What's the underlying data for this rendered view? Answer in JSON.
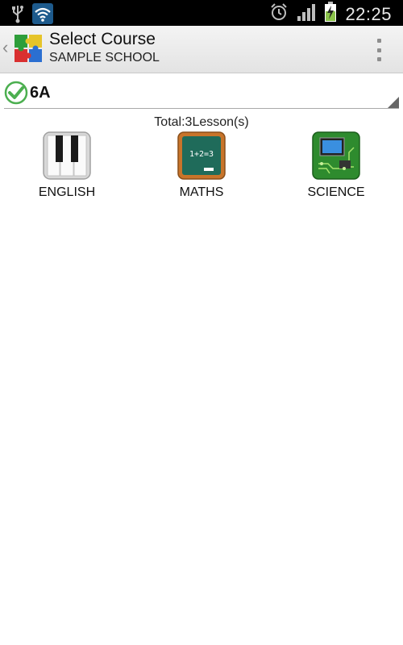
{
  "status_bar": {
    "time": "22:25",
    "icons": [
      "usb-icon",
      "wifi-icon",
      "alarm-icon",
      "signal-icon",
      "battery-charging-icon"
    ]
  },
  "action_bar": {
    "title": "Select Course",
    "subtitle": "SAMPLE SCHOOL",
    "back_icon": "chevron-left-icon",
    "logo_icon": "puzzle-logo-icon",
    "menu_icon": "overflow-menu-icon"
  },
  "class_selector": {
    "value": "6A",
    "status_icon": "check-circle-icon"
  },
  "summary": {
    "total_text": "Total:3Lesson(s)"
  },
  "courses": [
    {
      "label": "ENGLISH",
      "icon": "piano-keys-icon"
    },
    {
      "label": "MATHS",
      "icon": "chalkboard-icon"
    },
    {
      "label": "SCIENCE",
      "icon": "circuit-chip-icon"
    }
  ],
  "colors": {
    "status_bar_bg": "#000000",
    "action_bar_bg": "#e8e8e8",
    "check_green": "#4caf50",
    "chalkboard_green": "#1f6b5a",
    "chalkboard_frame": "#c8742a",
    "circuit_green": "#2e8b2e"
  }
}
